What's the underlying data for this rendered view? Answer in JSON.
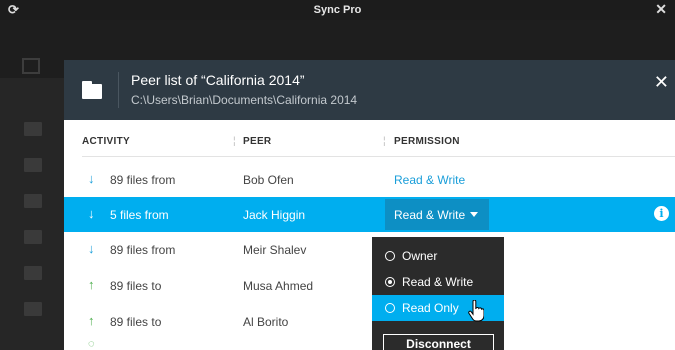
{
  "window": {
    "title": "Sync Pro"
  },
  "dialog": {
    "title": "Peer list of “California 2014”",
    "path": "C:\\Users\\Brian\\Documents\\California 2014"
  },
  "columns": {
    "activity": "ACTIVITY",
    "peer": "PEER",
    "permission": "PERMISSION"
  },
  "rows": [
    {
      "direction": "down",
      "activity": "89 files from",
      "peer": "Bob Ofen",
      "permission": "Read & Write"
    },
    {
      "direction": "down",
      "activity": "5 files from",
      "peer": "Jack Higgin",
      "permission": "Read & Write",
      "selected": true
    },
    {
      "direction": "down",
      "activity": "89 files from",
      "peer": "Meir Shalev",
      "permission": ""
    },
    {
      "direction": "up",
      "activity": "89 files to",
      "peer": "Musa Ahmed",
      "permission": ""
    },
    {
      "direction": "up",
      "activity": "89 files to",
      "peer": "Al Borito",
      "permission": ""
    }
  ],
  "arrows": {
    "down": "↓",
    "up": "↑"
  },
  "info_glyph": "i",
  "permission_menu": {
    "options": [
      {
        "label": "Owner",
        "checked": false,
        "highlighted": false
      },
      {
        "label": "Read & Write",
        "checked": true,
        "highlighted": false
      },
      {
        "label": "Read Only",
        "checked": false,
        "highlighted": true
      }
    ],
    "disconnect_label": "Disconnect"
  },
  "colors": {
    "accent": "#00aeef",
    "header": "#2e3a44",
    "up_arrow": "#4cae4c",
    "link": "#1a9ed9"
  }
}
